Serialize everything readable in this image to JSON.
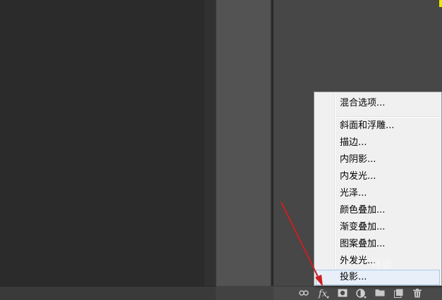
{
  "toolbar": {
    "fx_label": "fx",
    "icons": [
      "link-icon",
      "fx-icon",
      "mask-icon",
      "adjustment-icon",
      "folder-icon",
      "new-layer-icon",
      "trash-icon"
    ]
  },
  "context_menu": {
    "items": [
      {
        "label": "混合选项..."
      },
      {
        "label": "斜面和浮雕..."
      },
      {
        "label": "描边..."
      },
      {
        "label": "内阴影..."
      },
      {
        "label": "内发光..."
      },
      {
        "label": "光泽..."
      },
      {
        "label": "颜色叠加..."
      },
      {
        "label": "渐变叠加..."
      },
      {
        "label": "图案叠加..."
      },
      {
        "label": "外发光..."
      },
      {
        "label": "投影..."
      }
    ],
    "hovered_item": "投影..."
  },
  "watermark": {
    "text": "经验"
  },
  "colors": {
    "annotation_arrow": "#cc1f1f",
    "highlight_yellow": "#e8e800",
    "menu_bg": "#f0f0f0"
  }
}
